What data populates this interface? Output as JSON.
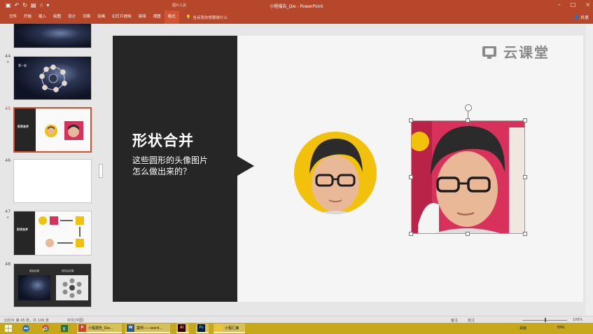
{
  "window": {
    "title": "小程报告_Qie - PowerPoint",
    "context_tab": "图片工具",
    "controls": [
      "–",
      "□",
      "×"
    ]
  },
  "ribbon": {
    "tabs": [
      "文件",
      "开始",
      "插入",
      "绘图",
      "设计",
      "切换",
      "动画",
      "幻灯片放映",
      "审阅",
      "视图",
      "格式"
    ],
    "active_tab": "格式",
    "tell_me": "告诉我你想要做什么",
    "share": "共享"
  },
  "thumbnails": [
    {
      "num": "44",
      "style": "galaxy-ring",
      "label": "第一部"
    },
    {
      "num": "45",
      "style": "current",
      "title": "形状合并"
    },
    {
      "num": "46",
      "style": "blank"
    },
    {
      "num": "47",
      "style": "steps",
      "title": "形状合并"
    },
    {
      "num": "48",
      "style": "gallery",
      "labels": [
        "原始效果",
        "修改后效果"
      ]
    }
  ],
  "slide": {
    "title": "形状合并",
    "subtitle_line1": "这些圆形的头像图片",
    "subtitle_line2": "怎么做出来的？",
    "logo_text": "云课堂",
    "colors": {
      "panel": "#262626",
      "circle": "#f2c10c",
      "photo_bg": "#d8315b",
      "accent": "#d35230"
    }
  },
  "status": {
    "slide_info": "幻灯片 第 45 张，共 106 张",
    "language": "中文(中国)",
    "notes": "备注",
    "comments": "批注",
    "zoom": "106%"
  },
  "taskbar": {
    "items": [
      {
        "label": "小程报告_Qie...",
        "icon": "powerpoint-icon"
      },
      {
        "label": "案例——word...",
        "icon": "word-icon"
      },
      {
        "label": "",
        "icon": "illustrator-icon"
      },
      {
        "label": "",
        "icon": "photoshop-icon"
      },
      {
        "label": "小程汇编",
        "icon": "folder-icon"
      }
    ],
    "tray_text": "桌面",
    "lang": "ENG"
  }
}
